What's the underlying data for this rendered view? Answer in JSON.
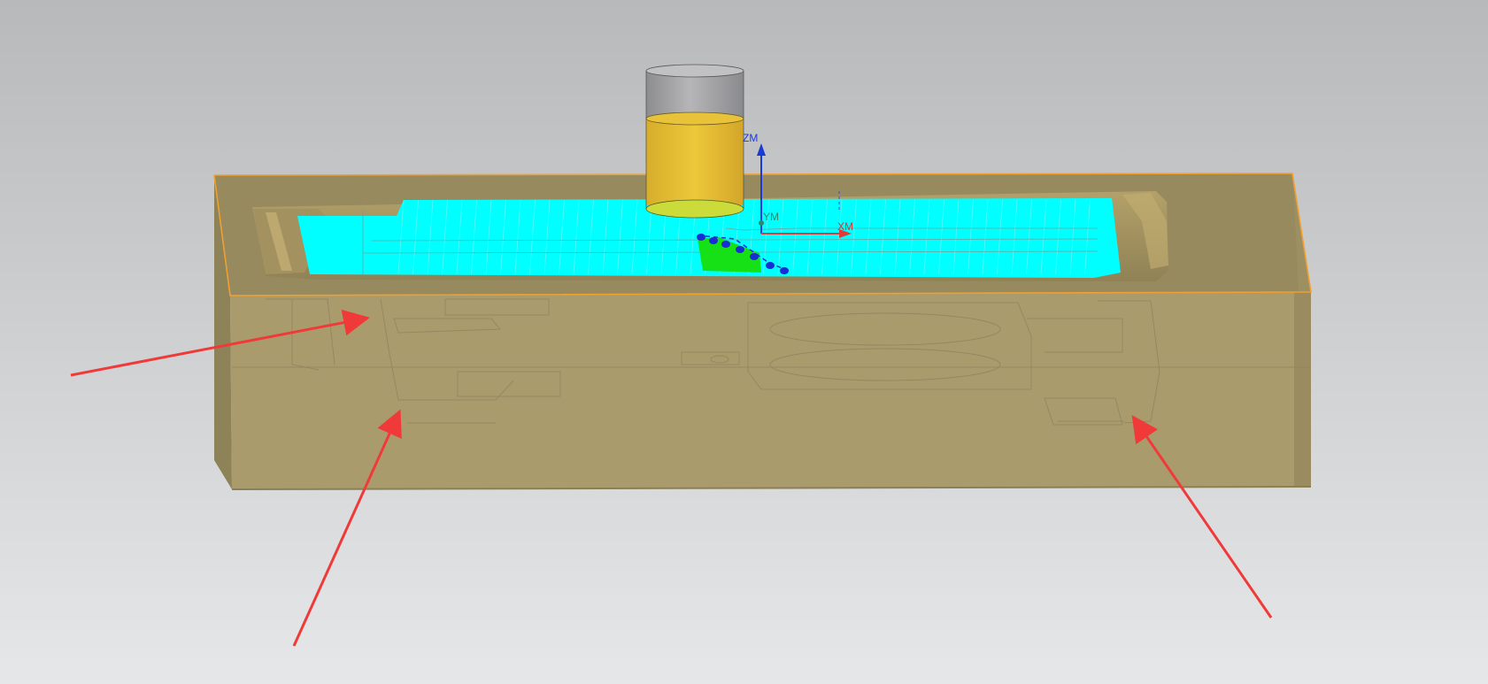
{
  "viewport": {
    "background_top": "#b8b9bb",
    "background_bottom": "#e6e7e9"
  },
  "part": {
    "top_face_color": "#978a5e",
    "front_face_color": "#aa9b6c",
    "left_face_color": "#8e8259",
    "right_face_color": "#9c8f62",
    "edge_highlight_color": "#f0a030",
    "outline_color": "#7d7250",
    "toolpath_color": "#00ffff"
  },
  "tool": {
    "shank_color": "#a7a7a9",
    "flute_color": "#e5c43a",
    "tip_color": "#cbdc3a"
  },
  "active_toolpath": {
    "color": "#16e016",
    "marker_color": "#1a2cd6"
  },
  "coordinate_system": {
    "z_label": "ZM",
    "y_label": "YM",
    "x_label": "XM",
    "z_color": "#1a3ad6",
    "y_color": "#2a8a6a",
    "x_color": "#e03a3a"
  },
  "annotation_arrows": {
    "color": "#f03a3a",
    "count": 3
  }
}
